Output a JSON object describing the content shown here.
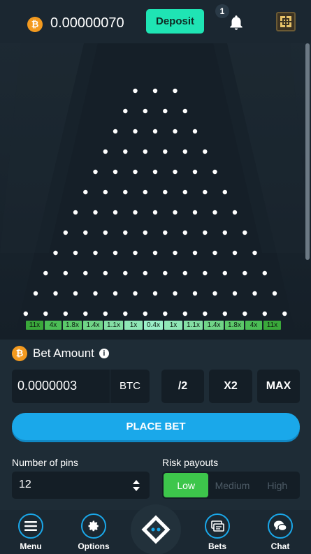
{
  "header": {
    "currency_icon": "bitcoin-icon",
    "currency_symbol": "₿",
    "balance": "0.00000070",
    "deposit_label": "Deposit",
    "notification_count": "1",
    "bell_icon": "bell-icon",
    "avatar_icon": "avatar-icon"
  },
  "board": {
    "pin_rows": 12,
    "multipliers": [
      {
        "label": "11x",
        "color": "#3aa83a"
      },
      {
        "label": "4x",
        "color": "#4bbd55"
      },
      {
        "label": "1.8x",
        "color": "#5cc96a"
      },
      {
        "label": "1.4x",
        "color": "#70d487"
      },
      {
        "label": "1.1x",
        "color": "#84dfa4"
      },
      {
        "label": "1x",
        "color": "#8fe6b6"
      },
      {
        "label": "0.4x",
        "color": "#9bf0c9"
      },
      {
        "label": "1x",
        "color": "#8fe6b6"
      },
      {
        "label": "1.1x",
        "color": "#84dfa4"
      },
      {
        "label": "1.4x",
        "color": "#70d487"
      },
      {
        "label": "1.8x",
        "color": "#5cc96a"
      },
      {
        "label": "4x",
        "color": "#4bbd55"
      },
      {
        "label": "11x",
        "color": "#3aa83a"
      }
    ]
  },
  "bet": {
    "currency_symbol": "₿",
    "title": "Bet Amount",
    "info_glyph": "i",
    "amount": "0.0000003",
    "unit": "BTC",
    "half_label": "/2",
    "double_label": "X2",
    "max_label": "MAX",
    "place_label": "PLACE BET"
  },
  "pins_setting": {
    "label": "Number of pins",
    "value": "12"
  },
  "risk": {
    "label": "Risk payouts",
    "options": [
      "Low",
      "Medium",
      "High"
    ],
    "selected": "Low"
  },
  "nav": {
    "menu": "Menu",
    "options": "Options",
    "bets": "Bets",
    "chat": "Chat"
  },
  "colors": {
    "accent": "#1aa8ea",
    "deposit": "#1fe4b4",
    "risk_active": "#3dc64b",
    "bitcoin": "#f39a1f"
  }
}
